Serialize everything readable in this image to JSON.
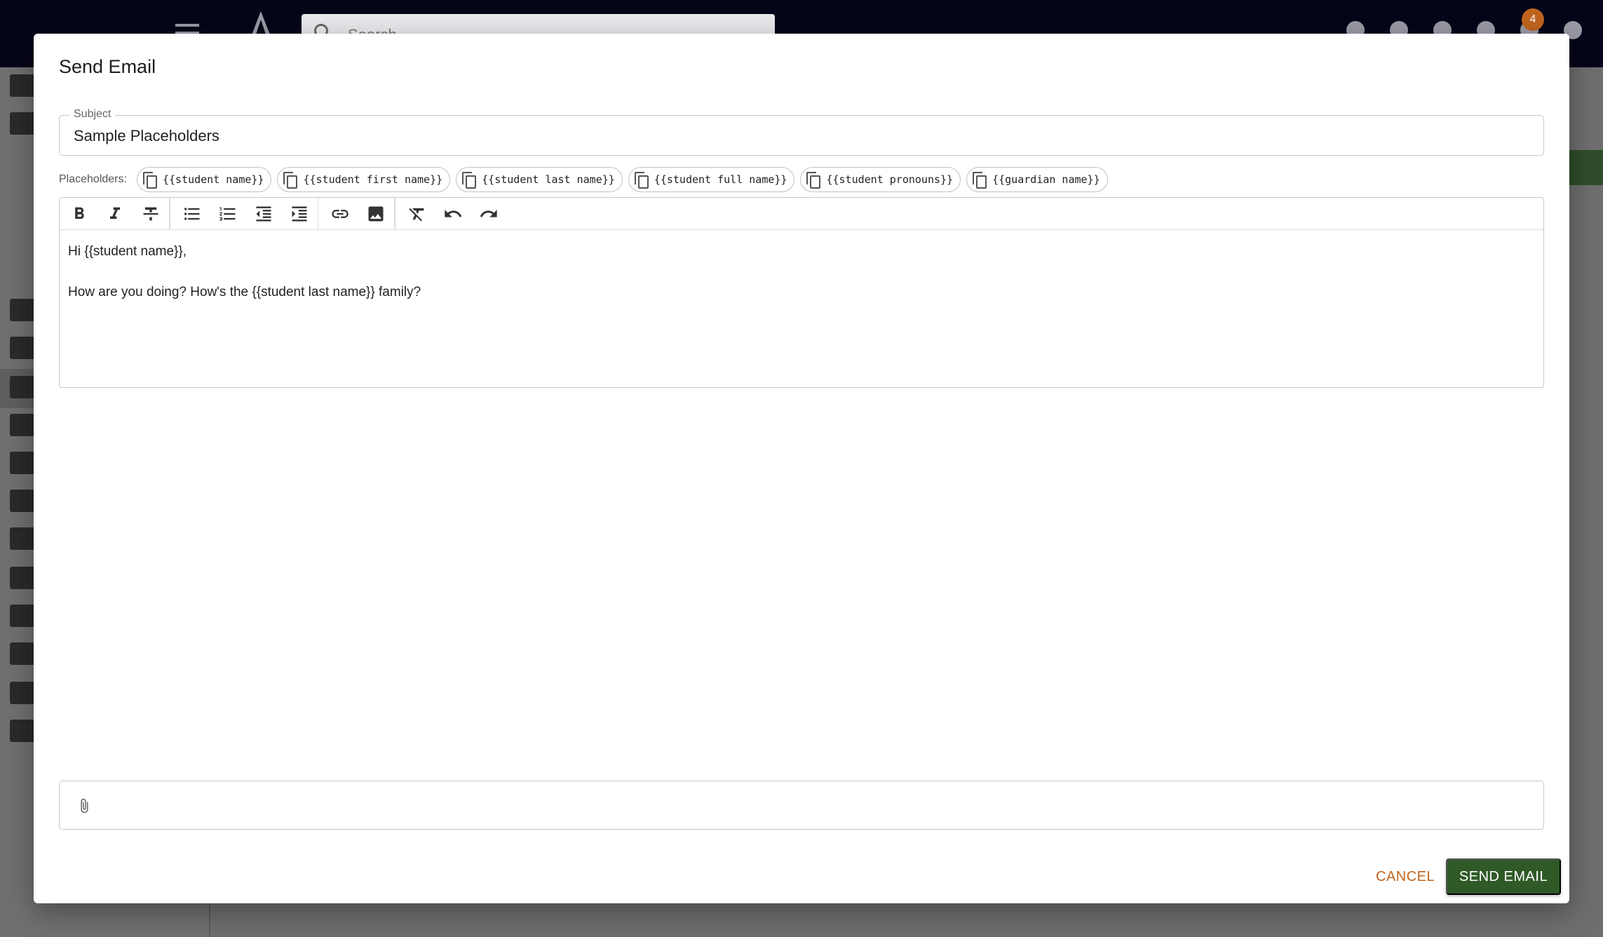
{
  "background": {
    "search_placeholder": "Search",
    "notification_count": "4"
  },
  "dialog": {
    "title": "Send Email",
    "subject_label": "Subject",
    "subject_value": "Sample Placeholders",
    "placeholders_label": "Placeholders:",
    "placeholders": [
      "{{student name}}",
      "{{student first name}}",
      "{{student last name}}",
      "{{student full name}}",
      "{{student pronouns}}",
      "{{guardian name}}"
    ],
    "toolbar_icons": [
      "bold-icon",
      "italic-icon",
      "strikethrough-icon",
      "bulleted-list-icon",
      "numbered-list-icon",
      "outdent-icon",
      "indent-icon",
      "link-icon",
      "image-icon",
      "clear-format-icon",
      "undo-icon",
      "redo-icon"
    ],
    "body_lines": [
      "Hi {{student name}},",
      "How are you doing? How's the {{student last name}} family?"
    ],
    "attachment_icon": "paperclip-icon",
    "cancel_label": "CANCEL",
    "send_label": "SEND EMAIL"
  },
  "colors": {
    "primary_green": "#2f5a28",
    "accent_orange": "#c0641e",
    "app_bar": "#050519"
  }
}
